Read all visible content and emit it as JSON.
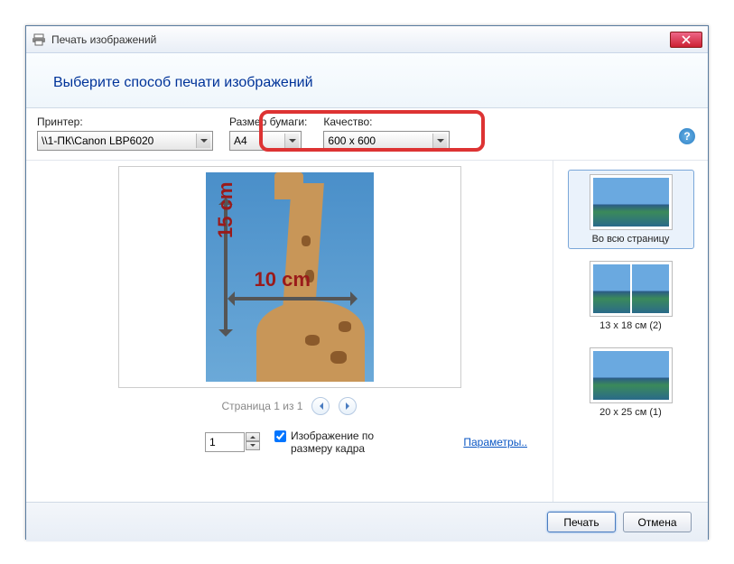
{
  "window": {
    "title": "Печать изображений"
  },
  "header": {
    "title": "Выберите способ печати изображений"
  },
  "options": {
    "printer": {
      "label": "Принтер:",
      "value": "\\\\1-ПК\\Canon LBP6020"
    },
    "paper": {
      "label": "Размер бумаги:",
      "value": "A4"
    },
    "quality": {
      "label": "Качество:",
      "value": "600 x 600"
    }
  },
  "preview": {
    "page_label": "Страница 1 из 1",
    "dim_v": "15 cm",
    "dim_h": "10 cm"
  },
  "controls": {
    "copies": "1",
    "fit_label": "Изображение по размеру кадра",
    "params_link": "Параметры.."
  },
  "layouts": [
    {
      "label": "Во всю страницу",
      "cols": 1
    },
    {
      "label": "13 x 18 см (2)",
      "cols": 2
    },
    {
      "label": "20 x 25 см (1)",
      "cols": 1
    }
  ],
  "footer": {
    "print": "Печать",
    "cancel": "Отмена"
  },
  "help_glyph": "?"
}
